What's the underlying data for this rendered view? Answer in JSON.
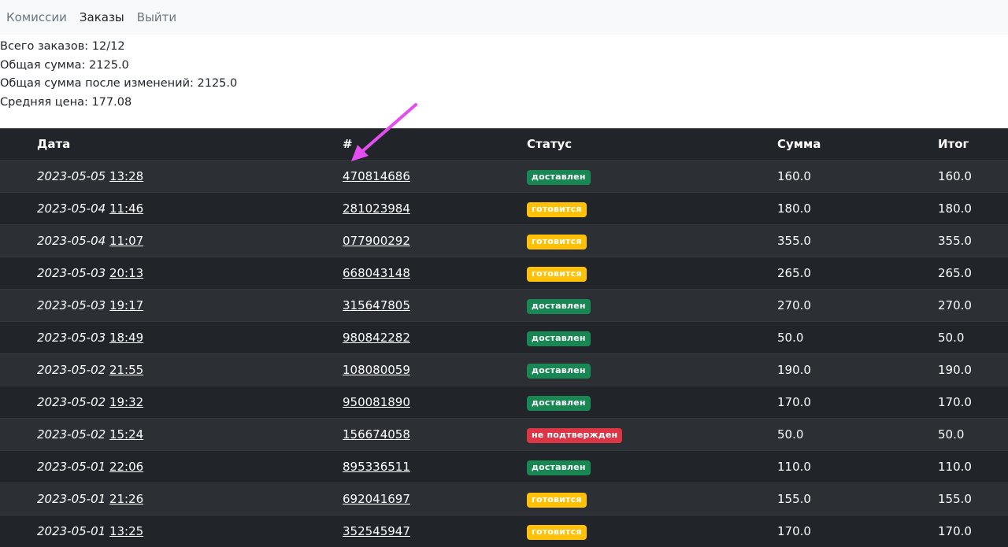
{
  "nav": {
    "items": [
      {
        "label": "Комиссии",
        "active": false
      },
      {
        "label": "Заказы",
        "active": true
      },
      {
        "label": "Выйти",
        "active": false
      }
    ]
  },
  "summary": {
    "total_orders": "Всего заказов: 12/12",
    "total_sum": "Общая сумма: 2125.0",
    "total_after_changes": "Общая сумма после изменений: 2125.0",
    "avg_price": "Средняя цена: 177.08"
  },
  "table": {
    "headers": [
      "Дата",
      "#",
      "Статус",
      "Сумма",
      "Итог"
    ],
    "rows": [
      {
        "date": "2023-05-05",
        "time": "13:28",
        "order": "470814686",
        "status": "доставлен",
        "status_type": "delivered",
        "sum": "160.0",
        "total": "160.0"
      },
      {
        "date": "2023-05-04",
        "time": "11:46",
        "order": "281023984",
        "status": "готовится",
        "status_type": "cooking",
        "sum": "180.0",
        "total": "180.0"
      },
      {
        "date": "2023-05-04",
        "time": "11:07",
        "order": "077900292",
        "status": "готовится",
        "status_type": "cooking",
        "sum": "355.0",
        "total": "355.0"
      },
      {
        "date": "2023-05-03",
        "time": "20:13",
        "order": "668043148",
        "status": "готовится",
        "status_type": "cooking",
        "sum": "265.0",
        "total": "265.0"
      },
      {
        "date": "2023-05-03",
        "time": "19:17",
        "order": "315647805",
        "status": "доставлен",
        "status_type": "delivered",
        "sum": "270.0",
        "total": "270.0"
      },
      {
        "date": "2023-05-03",
        "time": "18:49",
        "order": "980842282",
        "status": "доставлен",
        "status_type": "delivered",
        "sum": "50.0",
        "total": "50.0"
      },
      {
        "date": "2023-05-02",
        "time": "21:55",
        "order": "108080059",
        "status": "доставлен",
        "status_type": "delivered",
        "sum": "190.0",
        "total": "190.0"
      },
      {
        "date": "2023-05-02",
        "time": "19:32",
        "order": "950081890",
        "status": "доставлен",
        "status_type": "delivered",
        "sum": "170.0",
        "total": "170.0"
      },
      {
        "date": "2023-05-02",
        "time": "15:24",
        "order": "156674058",
        "status": "не подтвержден",
        "status_type": "unconfirmed",
        "sum": "50.0",
        "total": "50.0"
      },
      {
        "date": "2023-05-01",
        "time": "22:06",
        "order": "895336511",
        "status": "доставлен",
        "status_type": "delivered",
        "sum": "110.0",
        "total": "110.0"
      },
      {
        "date": "2023-05-01",
        "time": "21:26",
        "order": "692041697",
        "status": "готовится",
        "status_type": "cooking",
        "sum": "155.0",
        "total": "155.0"
      },
      {
        "date": "2023-05-01",
        "time": "13:25",
        "order": "352545947",
        "status": "готовится",
        "status_type": "cooking",
        "sum": "170.0",
        "total": "170.0"
      }
    ]
  },
  "colors": {
    "arrow": "#e44df0",
    "delivered": "#198754",
    "cooking": "#ffc107",
    "unconfirmed": "#dc3545"
  }
}
